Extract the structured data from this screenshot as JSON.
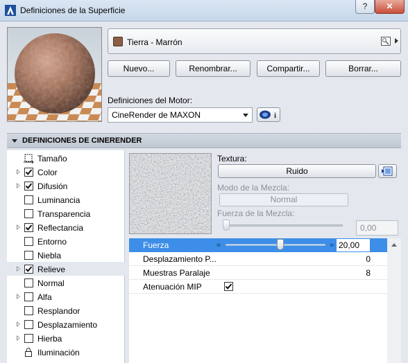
{
  "window": {
    "title": "Definiciones de la Superficie",
    "help_label": "?",
    "close_label": "✕"
  },
  "surface": {
    "name": "Tierra - Marrón",
    "swatch_color": "#8b5e45"
  },
  "buttons": {
    "new": "Nuevo...",
    "rename": "Renombrar...",
    "share": "Compartir...",
    "delete": "Borrar..."
  },
  "engine": {
    "label": "Definiciones del Motor:",
    "value": "CineRender de MAXON"
  },
  "section": {
    "title": "DEFINICIONES DE CINERENDER"
  },
  "channels": [
    {
      "label": "Tamaño",
      "expandable": false,
      "checked": null,
      "icon": "size-icon"
    },
    {
      "label": "Color",
      "expandable": true,
      "checked": true
    },
    {
      "label": "Difusión",
      "expandable": true,
      "checked": true
    },
    {
      "label": "Luminancia",
      "expandable": false,
      "checked": false
    },
    {
      "label": "Transparencia",
      "expandable": false,
      "checked": false
    },
    {
      "label": "Reflectancia",
      "expandable": true,
      "checked": true
    },
    {
      "label": "Entorno",
      "expandable": false,
      "checked": false
    },
    {
      "label": "Niebla",
      "expandable": false,
      "checked": false
    },
    {
      "label": "Relieve",
      "expandable": true,
      "checked": true,
      "selected": true
    },
    {
      "label": "Normal",
      "expandable": false,
      "checked": false
    },
    {
      "label": "Alfa",
      "expandable": true,
      "checked": false
    },
    {
      "label": "Resplandor",
      "expandable": false,
      "checked": false
    },
    {
      "label": "Desplazamiento",
      "expandable": true,
      "checked": false
    },
    {
      "label": "Hierba",
      "expandable": true,
      "checked": false
    },
    {
      "label": "Iluminación",
      "expandable": false,
      "checked": null,
      "icon": "lock-icon"
    }
  ],
  "texture": {
    "label": "Textura:",
    "button": "Ruido",
    "blend_mode_label": "Modo de la Mezcla:",
    "blend_mode_value": "Normal",
    "blend_strength_label": "Fuerza de la Mezcla:",
    "blend_strength_value": "0,00",
    "blend_strength_level": 0
  },
  "params": {
    "strength": {
      "label": "Fuerza",
      "value": "20,00",
      "level": 0.55
    },
    "displacement": {
      "label": "Desplazamiento P...",
      "value": "0"
    },
    "parallax_samples": {
      "label": "Muestras Paralaje",
      "value": "8"
    },
    "mip_falloff": {
      "label": "Atenuación MIP",
      "checked": true
    }
  },
  "colors": {
    "accent": "#3d8ee8",
    "selection_row": "#e3e8ef"
  }
}
